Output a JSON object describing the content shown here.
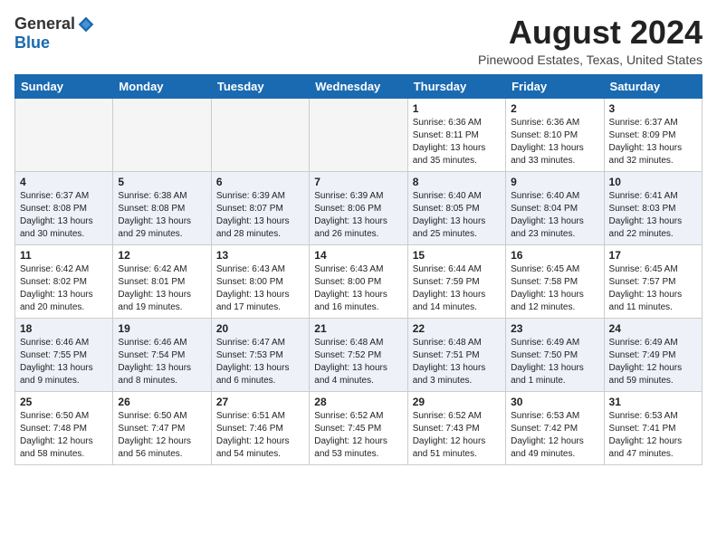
{
  "header": {
    "logo_general": "General",
    "logo_blue": "Blue",
    "month_title": "August 2024",
    "location": "Pinewood Estates, Texas, United States"
  },
  "weekdays": [
    "Sunday",
    "Monday",
    "Tuesday",
    "Wednesday",
    "Thursday",
    "Friday",
    "Saturday"
  ],
  "weeks": [
    [
      {
        "day": "",
        "info": ""
      },
      {
        "day": "",
        "info": ""
      },
      {
        "day": "",
        "info": ""
      },
      {
        "day": "",
        "info": ""
      },
      {
        "day": "1",
        "info": "Sunrise: 6:36 AM\nSunset: 8:11 PM\nDaylight: 13 hours\nand 35 minutes."
      },
      {
        "day": "2",
        "info": "Sunrise: 6:36 AM\nSunset: 8:10 PM\nDaylight: 13 hours\nand 33 minutes."
      },
      {
        "day": "3",
        "info": "Sunrise: 6:37 AM\nSunset: 8:09 PM\nDaylight: 13 hours\nand 32 minutes."
      }
    ],
    [
      {
        "day": "4",
        "info": "Sunrise: 6:37 AM\nSunset: 8:08 PM\nDaylight: 13 hours\nand 30 minutes."
      },
      {
        "day": "5",
        "info": "Sunrise: 6:38 AM\nSunset: 8:08 PM\nDaylight: 13 hours\nand 29 minutes."
      },
      {
        "day": "6",
        "info": "Sunrise: 6:39 AM\nSunset: 8:07 PM\nDaylight: 13 hours\nand 28 minutes."
      },
      {
        "day": "7",
        "info": "Sunrise: 6:39 AM\nSunset: 8:06 PM\nDaylight: 13 hours\nand 26 minutes."
      },
      {
        "day": "8",
        "info": "Sunrise: 6:40 AM\nSunset: 8:05 PM\nDaylight: 13 hours\nand 25 minutes."
      },
      {
        "day": "9",
        "info": "Sunrise: 6:40 AM\nSunset: 8:04 PM\nDaylight: 13 hours\nand 23 minutes."
      },
      {
        "day": "10",
        "info": "Sunrise: 6:41 AM\nSunset: 8:03 PM\nDaylight: 13 hours\nand 22 minutes."
      }
    ],
    [
      {
        "day": "11",
        "info": "Sunrise: 6:42 AM\nSunset: 8:02 PM\nDaylight: 13 hours\nand 20 minutes."
      },
      {
        "day": "12",
        "info": "Sunrise: 6:42 AM\nSunset: 8:01 PM\nDaylight: 13 hours\nand 19 minutes."
      },
      {
        "day": "13",
        "info": "Sunrise: 6:43 AM\nSunset: 8:00 PM\nDaylight: 13 hours\nand 17 minutes."
      },
      {
        "day": "14",
        "info": "Sunrise: 6:43 AM\nSunset: 8:00 PM\nDaylight: 13 hours\nand 16 minutes."
      },
      {
        "day": "15",
        "info": "Sunrise: 6:44 AM\nSunset: 7:59 PM\nDaylight: 13 hours\nand 14 minutes."
      },
      {
        "day": "16",
        "info": "Sunrise: 6:45 AM\nSunset: 7:58 PM\nDaylight: 13 hours\nand 12 minutes."
      },
      {
        "day": "17",
        "info": "Sunrise: 6:45 AM\nSunset: 7:57 PM\nDaylight: 13 hours\nand 11 minutes."
      }
    ],
    [
      {
        "day": "18",
        "info": "Sunrise: 6:46 AM\nSunset: 7:55 PM\nDaylight: 13 hours\nand 9 minutes."
      },
      {
        "day": "19",
        "info": "Sunrise: 6:46 AM\nSunset: 7:54 PM\nDaylight: 13 hours\nand 8 minutes."
      },
      {
        "day": "20",
        "info": "Sunrise: 6:47 AM\nSunset: 7:53 PM\nDaylight: 13 hours\nand 6 minutes."
      },
      {
        "day": "21",
        "info": "Sunrise: 6:48 AM\nSunset: 7:52 PM\nDaylight: 13 hours\nand 4 minutes."
      },
      {
        "day": "22",
        "info": "Sunrise: 6:48 AM\nSunset: 7:51 PM\nDaylight: 13 hours\nand 3 minutes."
      },
      {
        "day": "23",
        "info": "Sunrise: 6:49 AM\nSunset: 7:50 PM\nDaylight: 13 hours\nand 1 minute."
      },
      {
        "day": "24",
        "info": "Sunrise: 6:49 AM\nSunset: 7:49 PM\nDaylight: 12 hours\nand 59 minutes."
      }
    ],
    [
      {
        "day": "25",
        "info": "Sunrise: 6:50 AM\nSunset: 7:48 PM\nDaylight: 12 hours\nand 58 minutes."
      },
      {
        "day": "26",
        "info": "Sunrise: 6:50 AM\nSunset: 7:47 PM\nDaylight: 12 hours\nand 56 minutes."
      },
      {
        "day": "27",
        "info": "Sunrise: 6:51 AM\nSunset: 7:46 PM\nDaylight: 12 hours\nand 54 minutes."
      },
      {
        "day": "28",
        "info": "Sunrise: 6:52 AM\nSunset: 7:45 PM\nDaylight: 12 hours\nand 53 minutes."
      },
      {
        "day": "29",
        "info": "Sunrise: 6:52 AM\nSunset: 7:43 PM\nDaylight: 12 hours\nand 51 minutes."
      },
      {
        "day": "30",
        "info": "Sunrise: 6:53 AM\nSunset: 7:42 PM\nDaylight: 12 hours\nand 49 minutes."
      },
      {
        "day": "31",
        "info": "Sunrise: 6:53 AM\nSunset: 7:41 PM\nDaylight: 12 hours\nand 47 minutes."
      }
    ]
  ]
}
